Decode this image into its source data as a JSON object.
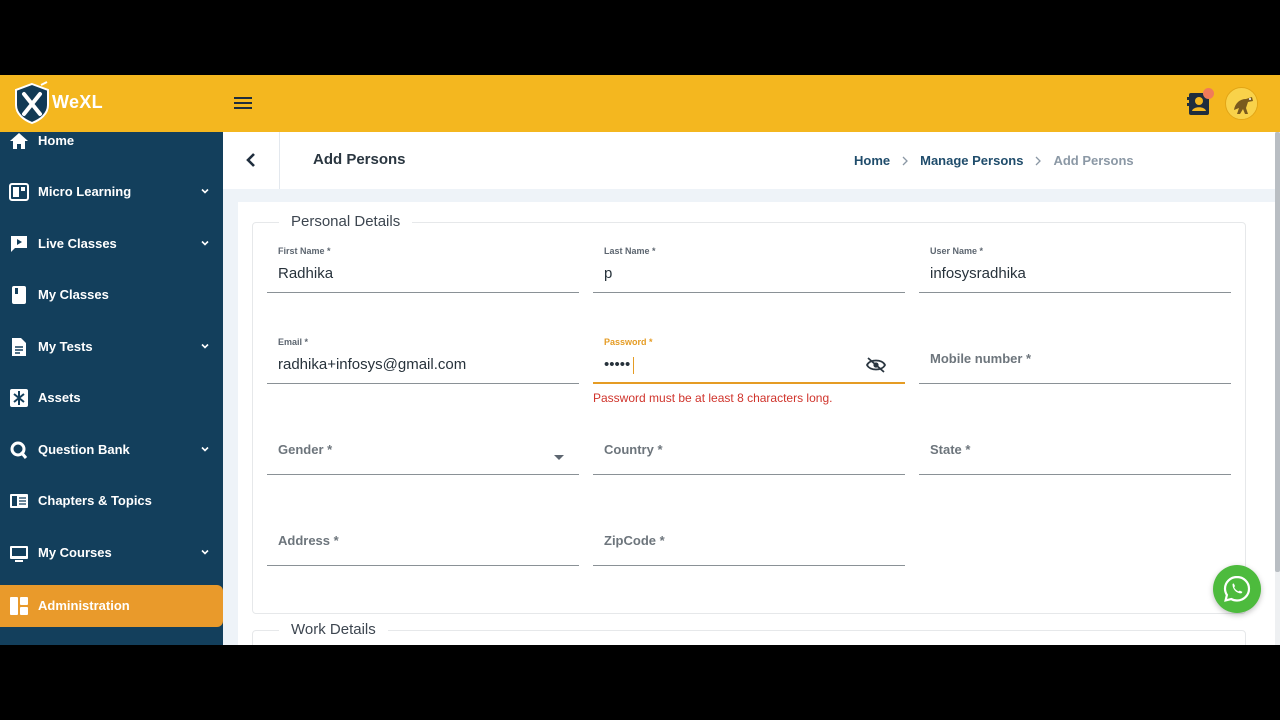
{
  "app": {
    "name": "WeXL"
  },
  "colors": {
    "topbar": "#f4b71f",
    "sidebar": "#133f5c",
    "active_nav": "#e99a2b",
    "error": "#d0342c",
    "focus": "#e59c24"
  },
  "topbar": {
    "menu_icon": "hamburger-icon",
    "contacts_icon": "contacts-icon",
    "avatar_icon": "avatar-dinosaur"
  },
  "sidebar": {
    "items": [
      {
        "label": "Home",
        "icon": "home-icon",
        "has_chevron": false
      },
      {
        "label": "Micro Learning",
        "icon": "micro-learning-icon",
        "has_chevron": true
      },
      {
        "label": "Live Classes",
        "icon": "live-classes-icon",
        "has_chevron": true
      },
      {
        "label": "My Classes",
        "icon": "book-icon",
        "has_chevron": false
      },
      {
        "label": "My Tests",
        "icon": "document-icon",
        "has_chevron": true
      },
      {
        "label": "Assets",
        "icon": "assets-icon",
        "has_chevron": false
      },
      {
        "label": "Question Bank",
        "icon": "question-icon",
        "has_chevron": true
      },
      {
        "label": "Chapters & Topics",
        "icon": "chapters-icon",
        "has_chevron": false
      },
      {
        "label": "My Courses",
        "icon": "courses-icon",
        "has_chevron": true
      },
      {
        "label": "Administration",
        "icon": "administration-icon",
        "has_chevron": false,
        "active": true
      }
    ]
  },
  "page": {
    "title": "Add Persons",
    "breadcrumb": [
      "Home",
      "Manage Persons",
      "Add Persons"
    ]
  },
  "personal": {
    "legend": "Personal Details",
    "first_name": {
      "label": "First Name *",
      "value": "Radhika"
    },
    "last_name": {
      "label": "Last Name *",
      "value": "p"
    },
    "user_name": {
      "label": "User Name *",
      "value": "infosysradhika"
    },
    "email": {
      "label": "Email *",
      "value": "radhika+infosys@gmail.com"
    },
    "password": {
      "label": "Password *",
      "value": "•••••",
      "error": "Password must be at least 8 characters long."
    },
    "mobile": {
      "placeholder": "Mobile number *"
    },
    "gender": {
      "placeholder": "Gender *"
    },
    "country": {
      "placeholder": "Country *"
    },
    "state": {
      "placeholder": "State *"
    },
    "address": {
      "placeholder": "Address *"
    },
    "zipcode": {
      "placeholder": "ZipCode *"
    }
  },
  "work": {
    "legend": "Work Details"
  }
}
